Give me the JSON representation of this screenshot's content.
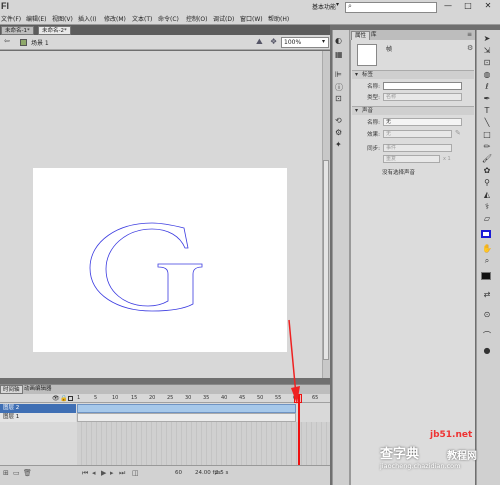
{
  "app": {
    "logo": "Fl",
    "workspace": "基本功能",
    "search_placeholder": ""
  },
  "menu": [
    "文件(F)",
    "编辑(E)",
    "视图(V)",
    "插入(I)",
    "修改(M)",
    "文本(T)",
    "命令(C)",
    "控制(O)",
    "调试(D)",
    "窗口(W)",
    "帮助(H)"
  ],
  "window_controls": [
    "—",
    "□",
    "✕"
  ],
  "doc_tabs": [
    "未命名-1*",
    "未命名-2*"
  ],
  "scene": {
    "label": "场景 1",
    "zoom": "100%"
  },
  "stage": {
    "glyph": "G",
    "outline_color": "#3b3be0",
    "background": "#ffffff"
  },
  "timeline": {
    "tabs": [
      "时间轴",
      "动画编辑器"
    ],
    "layers": [
      {
        "name": "图层 2",
        "selected": true
      },
      {
        "name": "图层 1",
        "selected": false
      }
    ],
    "ticks": [
      "1",
      "5",
      "10",
      "15",
      "20",
      "25",
      "30",
      "35",
      "40",
      "45",
      "50",
      "55",
      "60",
      "65"
    ],
    "footer": {
      "current_frame": "60",
      "fps": "24.00 fps",
      "elapsed": "2.5 s"
    }
  },
  "properties": {
    "tabs": [
      "属性",
      "库"
    ],
    "symbol_name": "帧",
    "label_section": "标签",
    "name_label": "名称:",
    "type_label": "类型:",
    "type_value": "名称",
    "sound_section": "声音",
    "sound_name_label": "名称:",
    "sound_name_value": "无",
    "effect_label": "效果:",
    "effect_value": "无",
    "sync_label": "同步:",
    "sync_value": "事件",
    "repeat_value": "重复",
    "repeat_count": "x 1",
    "no_sound": "没有选择声音"
  },
  "colors": {
    "stroke": "#1b1bd6",
    "fill": "#111111",
    "accent": "#3f6fb4"
  },
  "watermark": {
    "line1": "查字典",
    "line2": "教程网",
    "line3": "jiaocheng.chazidian.com",
    "site": "jb51.net"
  }
}
